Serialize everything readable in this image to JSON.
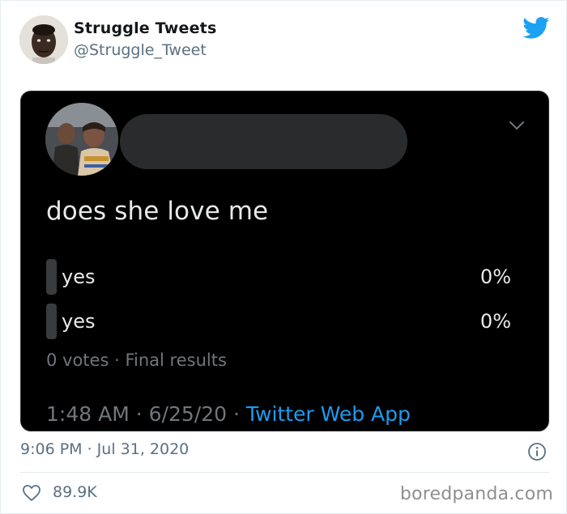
{
  "author": {
    "name": "Struggle Tweets",
    "handle": "@Struggle_Tweet"
  },
  "embedded_tweet": {
    "question": "does she love me",
    "poll": {
      "options": [
        {
          "label": "yes",
          "percent": "0%",
          "share": 0
        },
        {
          "label": "yes",
          "percent": "0%",
          "share": 0
        }
      ],
      "votes": "0 votes",
      "separator": "·",
      "status": "Final results"
    },
    "time": "1:48 AM",
    "date": "6/25/20",
    "dot": "·",
    "app": "Twitter Web App"
  },
  "footer": {
    "timestamp": "9:06 PM · Jul 31, 2020",
    "likes": "89.9K",
    "watermark": "boredpanda.com"
  },
  "colors": {
    "twitter_blue": "#1da1f2",
    "dark_bg": "#000000",
    "link_blue": "#1d9bf0",
    "muted": "#5b7083"
  },
  "icons": [
    "twitter-bird-icon",
    "chevron-down-icon",
    "info-icon",
    "heart-icon"
  ]
}
